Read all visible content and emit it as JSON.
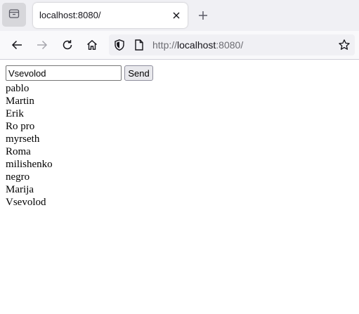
{
  "browser": {
    "tab": {
      "title": "localhost:8080/"
    },
    "url": {
      "protocol": "http://",
      "host": "localhost",
      "rest": ":8080/"
    }
  },
  "chat": {
    "input_value": "Vsevolod",
    "send_label": "Send",
    "messages": [
      "pablo",
      "Martin",
      "Erik",
      "Ro pro",
      "myrseth",
      "Roma",
      "milishenko",
      "negro",
      "Marija",
      "Vsevolod"
    ]
  },
  "icons": {
    "tabs_list": "tab-list-icon",
    "close": "close-icon",
    "new_tab": "plus-icon",
    "back": "arrow-left-icon",
    "forward": "arrow-right-icon",
    "reload": "reload-icon",
    "home": "home-icon",
    "tracking": "shield-icon",
    "page_info": "page-icon",
    "bookmark": "star-icon"
  }
}
